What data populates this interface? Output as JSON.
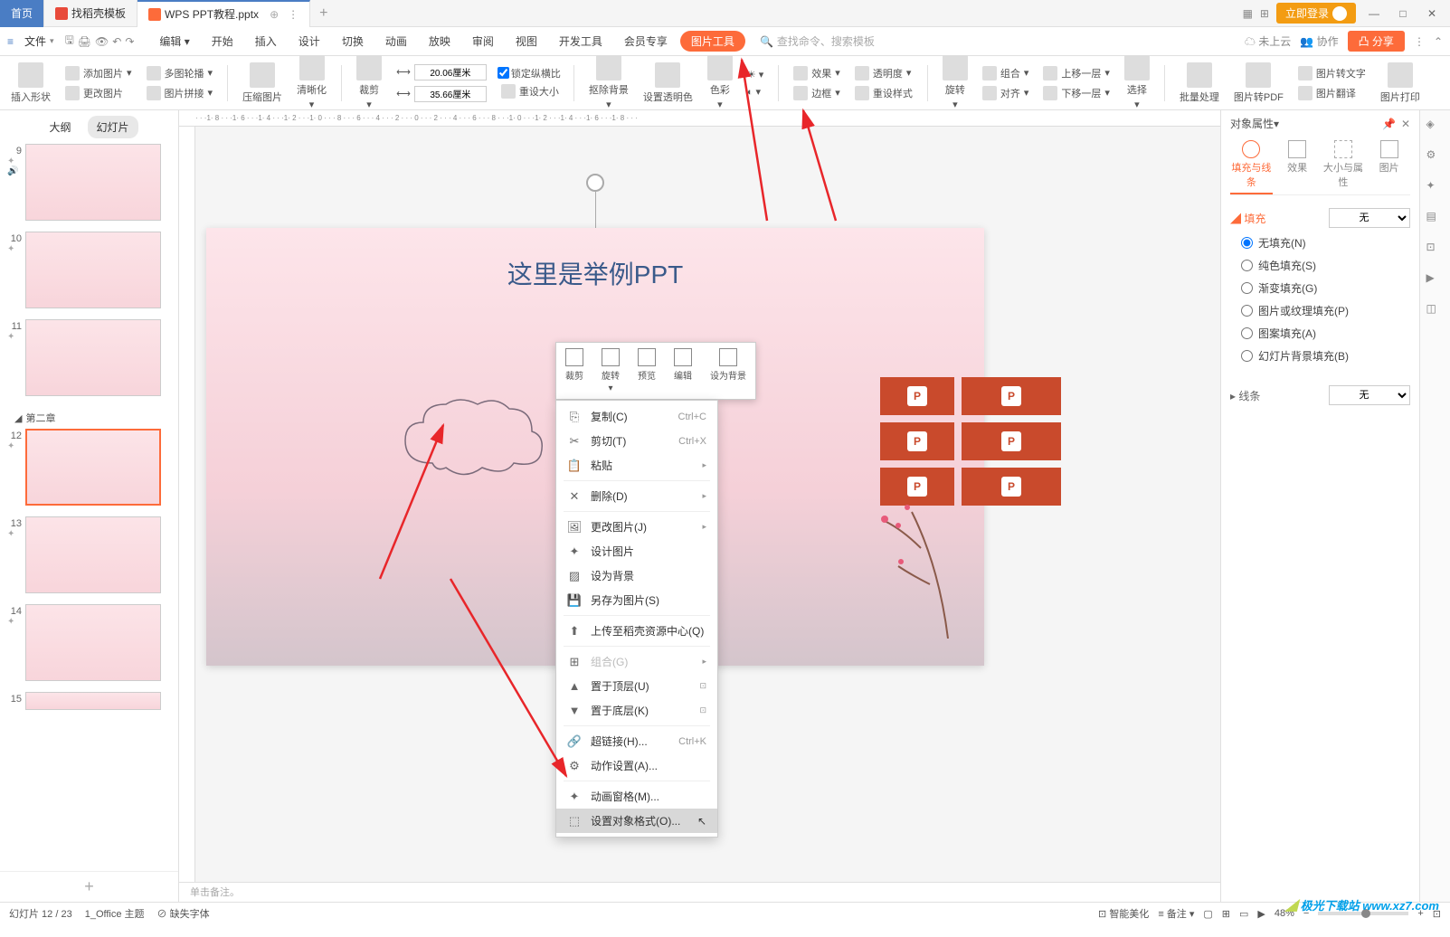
{
  "titlebar": {
    "home": "首页",
    "tab2": "找稻壳模板",
    "tab3": "WPS PPT教程.pptx",
    "login": "立即登录"
  },
  "menubar": {
    "file": "文件",
    "items": [
      "编辑",
      "开始",
      "插入",
      "设计",
      "切换",
      "动画",
      "放映",
      "审阅",
      "视图",
      "开发工具",
      "会员专享",
      "图片工具"
    ],
    "search_placeholder": "查找命令、搜索模板",
    "cloud": "未上云",
    "coop": "协作",
    "share": "分享"
  },
  "ribbon": {
    "insert_shape": "插入形状",
    "add_pic": "添加图片",
    "multi_carousel": "多图轮播",
    "change_pic": "更改图片",
    "pic_splice": "图片拼接",
    "compress": "压缩图片",
    "clarity": "清晰化",
    "crop": "裁剪",
    "width": "20.06厘米",
    "height": "35.66厘米",
    "lock_ratio": "锁定纵横比",
    "reset_size": "重设大小",
    "remove_bg": "抠除背景",
    "set_transparent": "设置透明色",
    "color": "色彩",
    "effect": "效果",
    "transparency": "透明度",
    "border": "边框",
    "reset_style": "重设样式",
    "rotate": "旋转",
    "combine": "组合",
    "align": "对齐",
    "move_up": "上移一层",
    "move_down": "下移一层",
    "select": "选择",
    "batch": "批量处理",
    "pic_to_pdf": "图片转PDF",
    "pic_to_text": "图片转文字",
    "pic_translate": "图片翻译",
    "pic_print": "图片打印"
  },
  "sidebar": {
    "outline": "大纲",
    "slides": "幻灯片",
    "section2": "第二章",
    "nums": [
      "9",
      "10",
      "11",
      "12",
      "13",
      "14",
      "15"
    ]
  },
  "canvas": {
    "title": "这里是举例PPT",
    "notes_placeholder": "单击备注。"
  },
  "mini_toolbar": {
    "crop": "裁剪",
    "rotate": "旋转",
    "preview": "预览",
    "edit": "编辑",
    "set_bg": "设为背景"
  },
  "context_menu": {
    "copy": "复制(C)",
    "copy_sc": "Ctrl+C",
    "cut": "剪切(T)",
    "cut_sc": "Ctrl+X",
    "paste": "粘贴",
    "delete": "删除(D)",
    "change_pic": "更改图片(J)",
    "design_pic": "设计图片",
    "set_bg": "设为背景",
    "save_as_pic": "另存为图片(S)",
    "upload": "上传至稻壳资源中心(Q)",
    "combine": "组合(G)",
    "to_front": "置于顶层(U)",
    "to_back": "置于底层(K)",
    "hyperlink": "超链接(H)...",
    "hyperlink_sc": "Ctrl+K",
    "action": "动作设置(A)...",
    "anim_pane": "动画窗格(M)...",
    "format": "设置对象格式(O)..."
  },
  "right_panel": {
    "title": "对象属性",
    "tab_fill": "填充与线条",
    "tab_effect": "效果",
    "tab_size": "大小与属性",
    "tab_pic": "图片",
    "fill_label": "填充",
    "fill_value": "无",
    "line_label": "线条",
    "line_value": "无",
    "radios": [
      "无填充(N)",
      "纯色填充(S)",
      "渐变填充(G)",
      "图片或纹理填充(P)",
      "图案填充(A)",
      "幻灯片背景填充(B)"
    ]
  },
  "statusbar": {
    "slide_info": "幻灯片 12 / 23",
    "theme": "1_Office 主题",
    "missing_font": "缺失字体",
    "smart": "智能美化",
    "notes": "备注",
    "zoom": "48%"
  },
  "ruler_h": "· · ·1· 8 · · ·1· 6 · · ·1· 4 · · ·1· 2 · · ·1· 0 · · · 8 · · · 6 · · · 4 · · · 2 · · · 0 · · · 2 · · · 4 · · · 6 · · · 8 · · ·1· 0 · · ·1· 2 · · ·1· 4 · · ·1· 6 · · ·1· 8 · · ·",
  "watermark": "极光下载站 www.xz7.com"
}
